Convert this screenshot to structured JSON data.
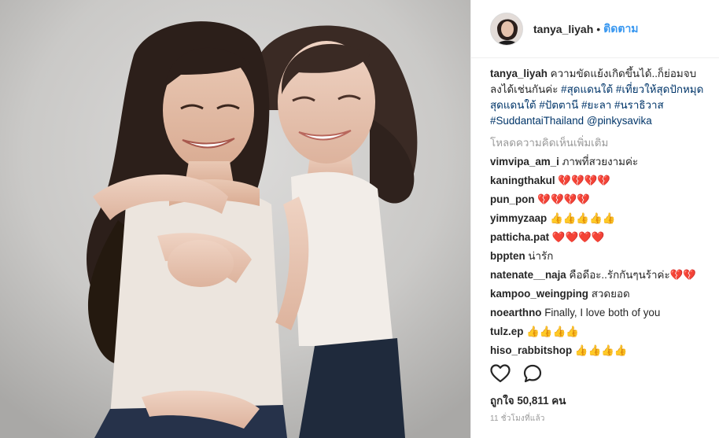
{
  "post": {
    "username": "tanya_liyah",
    "separator": "•",
    "follow_label": "ติดตาม",
    "caption": {
      "username": "tanya_liyah",
      "text": " ความขัดแย้งเกิดขึ้นได้..ก็ย่อมจบลงได้เช่นกันค่ะ ",
      "tag1": "#สุดแดนใต้",
      "space1": " ",
      "tag2": "#เที่ยวให้สุดปักหมุดสุดแดนใต้",
      "space2": " ",
      "tag3": "#ปัตตานี",
      "space3": " ",
      "tag4": "#ยะลา",
      "space4": " ",
      "tag5": "#นราธิวาส",
      "space5": " ",
      "tag6": "#SuddantaiThailand",
      "space6": " ",
      "mention": "@pinkysavika"
    },
    "load_more_label": "โหลดความคิดเห็นเพิ่มเติม",
    "comments": [
      {
        "user": "vimvipa_am_i",
        "text": "ภาพที่สวยงามค่ะ",
        "emoji": "",
        "emoji_type": ""
      },
      {
        "user": "kaningthakul",
        "text": "",
        "emoji": "💔💔💔💔",
        "emoji_type": "heart"
      },
      {
        "user": "pun_pon",
        "text": "",
        "emoji": "💔💔💔💔",
        "emoji_type": "heart"
      },
      {
        "user": "yimmyzaap",
        "text": "",
        "emoji": "👍👍👍👍👍",
        "emoji_type": "thumb"
      },
      {
        "user": "patticha.pat",
        "text": "",
        "emoji": "❤️❤️❤️❤️",
        "emoji_type": "heart"
      },
      {
        "user": "bppten",
        "text": "น่ารัก",
        "emoji": "",
        "emoji_type": ""
      },
      {
        "user": "natenate__naja",
        "text": "คือดีอะ..รักกันๆนร้าค่ะ",
        "emoji": "💔💔",
        "emoji_type": "heart"
      },
      {
        "user": "kampoo_weingping",
        "text": "สวดยอด",
        "emoji": "",
        "emoji_type": ""
      },
      {
        "user": "noearthno",
        "text": "Finally, I love both of you",
        "emoji": "",
        "emoji_type": ""
      },
      {
        "user": "tulz.ep",
        "text": "",
        "emoji": "👍👍👍👍",
        "emoji_type": "thumb"
      },
      {
        "user": "hiso_rabbitshop",
        "text": "",
        "emoji": "👍👍👍👍",
        "emoji_type": "thumb"
      }
    ],
    "likes_label": "ถูกใจ 50,811 คน",
    "timestamp": "11 ชั่วโมงที่แล้ว",
    "icons": {
      "like": "heart-outline-icon",
      "comment": "comment-bubble-icon"
    },
    "colors": {
      "link": "#3897f0",
      "hashtag": "#003569",
      "muted": "#999999",
      "text": "#262626"
    }
  }
}
